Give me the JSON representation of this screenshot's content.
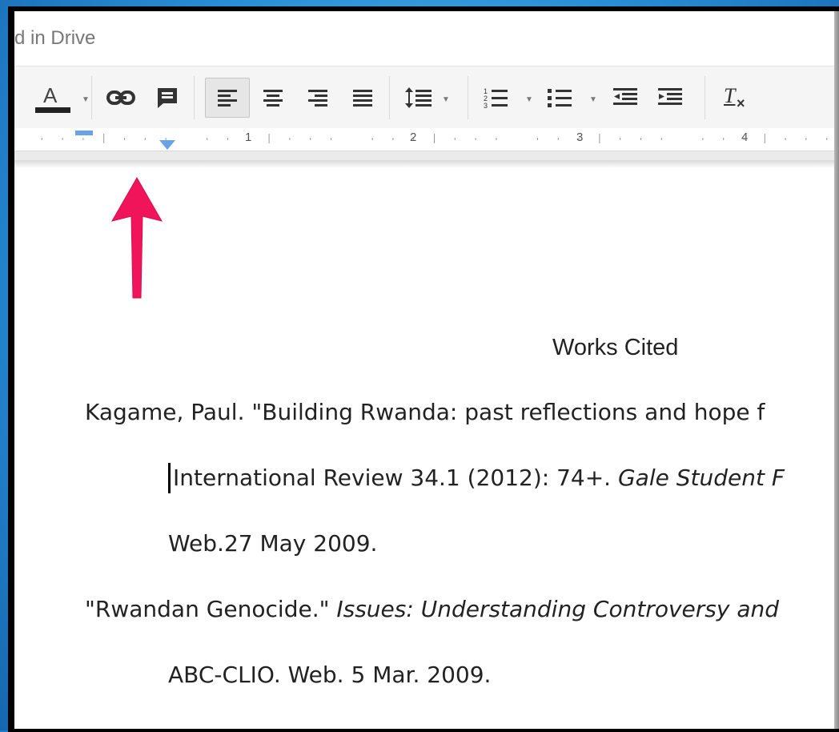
{
  "header": {
    "save_status": "d in Drive"
  },
  "toolbar": {
    "text_color_label": "A",
    "clear_formatting_label": "T"
  },
  "ruler": {
    "numbers": [
      "1",
      "2",
      "3",
      "4"
    ]
  },
  "document": {
    "title": "Works Cited",
    "entries": [
      {
        "line1_prefix": "Kagame, Paul. \"Building Rwanda: past reflections and hope f",
        "line2_prefix": "International Review 34.1 (2012): 74+. ",
        "line2_italic": "Gale Student F",
        "line3": "Web.27 May 2009."
      },
      {
        "line1_prefix": "\"Rwandan Genocide.\" ",
        "line1_italic": "Issues: Understanding Controversy and",
        "line2": "ABC-CLIO. Web. 5 Mar. 2009."
      }
    ]
  },
  "colors": {
    "annotation_arrow": "#f0145a",
    "indent_marker": "#6aa2e8",
    "background_blue": "#2a8fd6"
  },
  "icons": [
    "text-color-icon",
    "link-icon",
    "comment-icon",
    "align-left-icon",
    "align-center-icon",
    "align-right-icon",
    "justify-icon",
    "line-spacing-icon",
    "numbered-list-icon",
    "bulleted-list-icon",
    "decrease-indent-icon",
    "increase-indent-icon",
    "clear-formatting-icon"
  ]
}
